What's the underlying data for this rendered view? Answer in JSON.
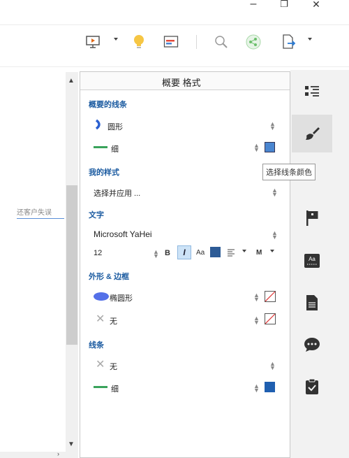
{
  "window": {
    "minimize_glyph": "–",
    "restore_glyph": "❐",
    "close_glyph": "✕"
  },
  "toolbar": {
    "icons": [
      "presentation-icon",
      "idea-icon",
      "gantt-icon",
      "search-icon",
      "share-icon",
      "export-icon"
    ]
  },
  "left_pane": {
    "partial_text": "还客户失误"
  },
  "panel": {
    "title": "概要 格式",
    "sections": {
      "summary_line": {
        "title": "概要的线条",
        "shape_label": "圆形",
        "weight_label": "细"
      },
      "my_style": {
        "title": "我的样式",
        "value": "选择并应用 ..."
      },
      "text": {
        "title": "文字",
        "font": "Microsoft YaHei",
        "size": "12",
        "bold": "B",
        "italic": "I",
        "case": "Aa",
        "more": "M"
      },
      "shape_border": {
        "title": "外形 & 边框",
        "shape_label": "椭圆形",
        "border_label": "无"
      },
      "line": {
        "title": "线条",
        "style_label": "无",
        "weight_label": "细"
      }
    }
  },
  "tooltip": {
    "text": "选择线条颜色"
  },
  "colors": {
    "section_title": "#1a5aa0",
    "line_green": "#3aa35b",
    "swatch_blue": "#4a86d0",
    "swatch_dark_blue": "#1f5fb0",
    "oval_blue": "#5470e8",
    "sidebar_icon": "#333333"
  },
  "sidebar": {
    "items": [
      "outline-icon",
      "format-brush-icon",
      "flag-icon",
      "text-label-icon",
      "notes-icon",
      "comment-icon",
      "task-icon"
    ]
  }
}
